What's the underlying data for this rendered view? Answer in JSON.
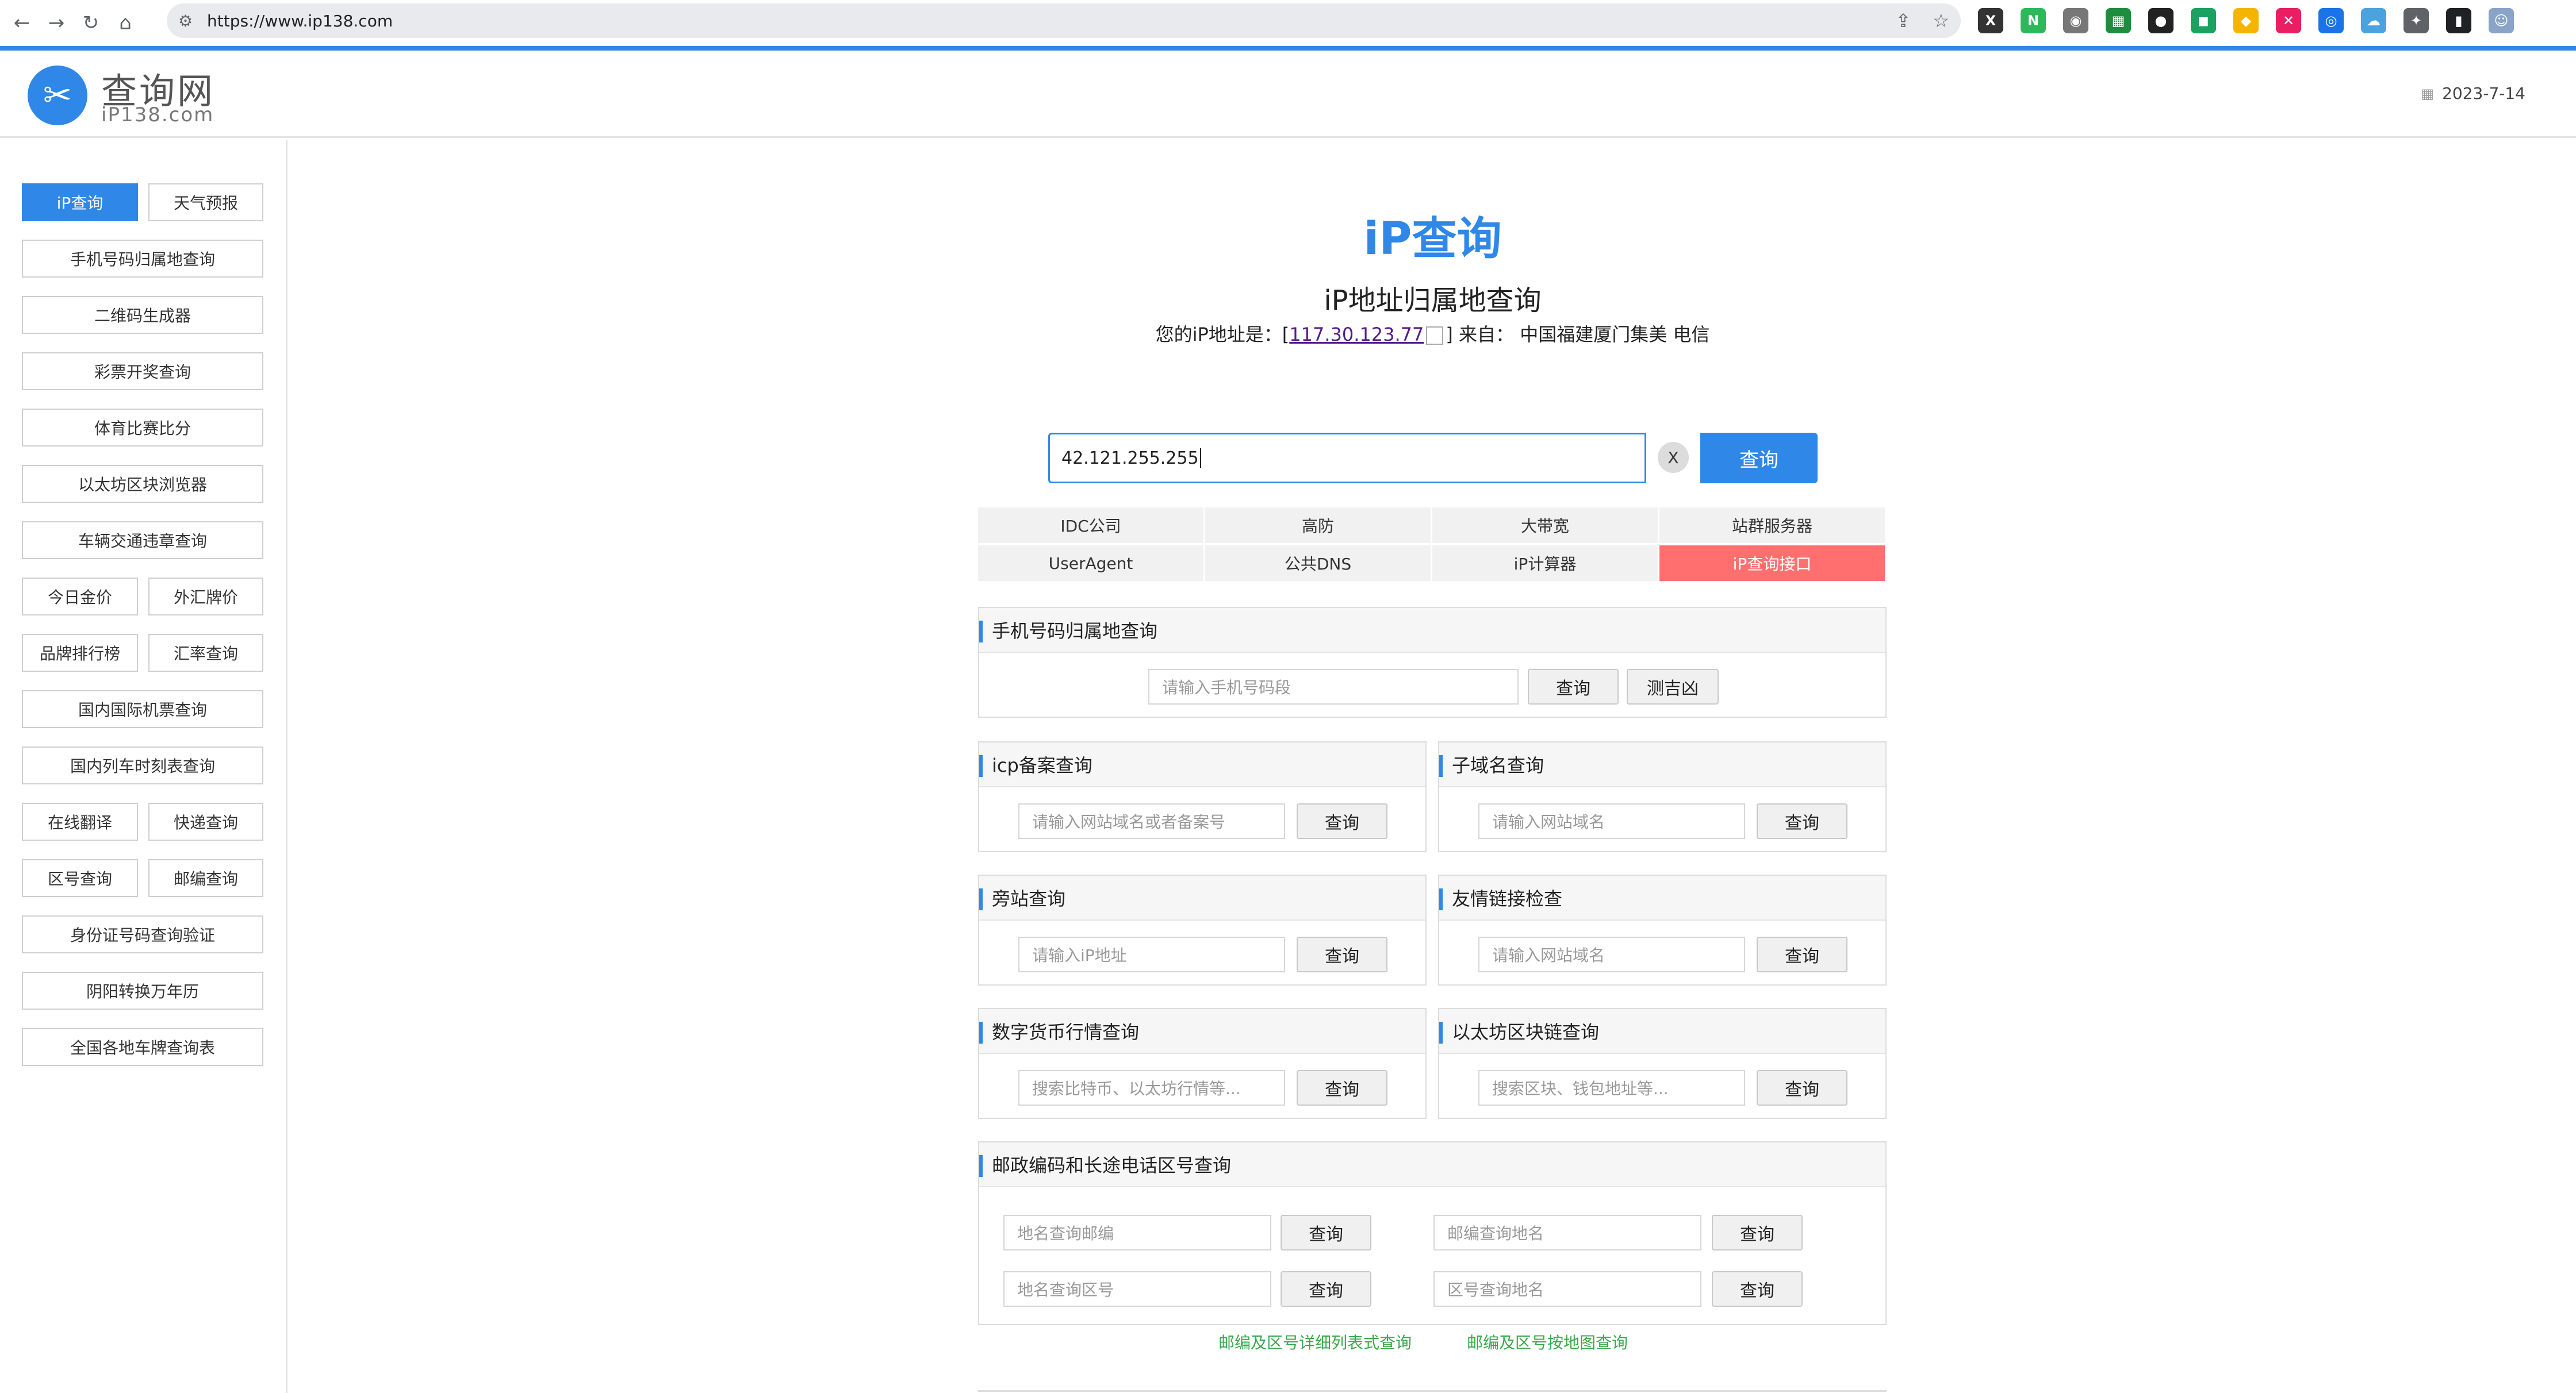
{
  "browser": {
    "url": "https://www.ip138.com",
    "nav_icons": [
      "back-icon",
      "forward-icon",
      "reload-icon",
      "home-icon"
    ],
    "extensions": [
      {
        "name": "x-ext-icon",
        "color": "#333333",
        "glyph": "X"
      },
      {
        "name": "n-ext-icon",
        "color": "#2eb85c",
        "glyph": "N"
      },
      {
        "name": "camera-ext-icon",
        "color": "#777777",
        "glyph": "◉"
      },
      {
        "name": "grid-ext-icon",
        "color": "#1e8e3e",
        "glyph": "▦"
      },
      {
        "name": "badge-ext-icon",
        "color": "#222222",
        "glyph": "●"
      },
      {
        "name": "green-ext-icon",
        "color": "#1aa260",
        "glyph": "◼"
      },
      {
        "name": "yellow-ext-icon",
        "color": "#f4b400",
        "glyph": "◆"
      },
      {
        "name": "pink-ext-icon",
        "color": "#e91e63",
        "glyph": "✕"
      },
      {
        "name": "blue-ext-icon",
        "color": "#1a73e8",
        "glyph": "◎"
      },
      {
        "name": "cloud-ext-icon",
        "color": "#4aa3df",
        "glyph": "☁"
      },
      {
        "name": "puzzle-ext-icon",
        "color": "#5f6368",
        "glyph": "✦"
      },
      {
        "name": "sidepanel-icon",
        "color": "#202124",
        "glyph": "▮"
      },
      {
        "name": "profile-avatar",
        "color": "#8aa4c8",
        "glyph": "☺"
      }
    ]
  },
  "header": {
    "logo_text": "查询网",
    "logo_sub": "iP138.com",
    "date": "2023-7-14"
  },
  "sidebar": {
    "items": [
      {
        "label": "iP查询",
        "active": true
      },
      {
        "label": "天气预报"
      },
      {
        "label": "手机号码归属地查询"
      },
      {
        "label": "二维码生成器"
      },
      {
        "label": "彩票开奖查询"
      },
      {
        "label": "体育比赛比分"
      },
      {
        "label": "以太坊区块浏览器"
      },
      {
        "label": "车辆交通违章查询"
      },
      {
        "label": "今日金价"
      },
      {
        "label": "外汇牌价"
      },
      {
        "label": "品牌排行榜"
      },
      {
        "label": "汇率查询"
      },
      {
        "label": "国内国际机票查询"
      },
      {
        "label": "国内列车时刻表查询"
      },
      {
        "label": "在线翻译"
      },
      {
        "label": "快递查询"
      },
      {
        "label": "区号查询"
      },
      {
        "label": "邮编查询"
      },
      {
        "label": "身份证号码查询验证"
      },
      {
        "label": "阴阳转换万年历"
      },
      {
        "label": "全国各地车牌查询表"
      }
    ]
  },
  "main": {
    "title": "iP查询",
    "subtitle": "iP地址归属地查询",
    "your_ip_prefix": "您的iP地址是：[",
    "your_ip": "117.30.123.77",
    "your_ip_suffix": "] 来自：",
    "your_ip_location": "中国福建厦门集美 电信",
    "search_value": "42.121.255.255",
    "clear_label": "X",
    "search_button": "查询",
    "quick_links": [
      {
        "label": "IDC公司"
      },
      {
        "label": "高防"
      },
      {
        "label": "大带宽"
      },
      {
        "label": "站群服务器"
      },
      {
        "label": "UserAgent"
      },
      {
        "label": "公共DNS"
      },
      {
        "label": "iP计算器"
      },
      {
        "label": "iP查询接口",
        "hot": true
      }
    ]
  },
  "panels": {
    "mobile": {
      "title": "手机号码归属地查询",
      "placeholder": "请输入手机号码段",
      "btn1": "查询",
      "btn2": "测吉凶"
    },
    "icp": {
      "title": "icp备案查询",
      "placeholder": "请输入网站域名或者备案号",
      "btn": "查询"
    },
    "subdomain": {
      "title": "子域名查询",
      "placeholder": "请输入网站域名",
      "btn": "查询"
    },
    "sameip": {
      "title": "旁站查询",
      "placeholder": "请输入iP地址",
      "btn": "查询"
    },
    "friendlink": {
      "title": "友情链接检查",
      "placeholder": "请输入网站域名",
      "btn": "查询"
    },
    "crypto": {
      "title": "数字货币行情查询",
      "placeholder": "搜索比特币、以太坊行情等...",
      "btn": "查询"
    },
    "eth": {
      "title": "以太坊区块链查询",
      "placeholder": "搜索区块、钱包地址等...",
      "btn": "查询"
    },
    "postal": {
      "title": "邮政编码和长途电话区号查询",
      "ph1": "地名查询邮编",
      "ph2": "邮编查询地名",
      "ph3": "地名查询区号",
      "ph4": "区号查询地名",
      "btn": "查询"
    }
  },
  "footer_links": {
    "list": "邮编及区号详细列表式查询",
    "map": "邮编及区号按地图查询"
  }
}
